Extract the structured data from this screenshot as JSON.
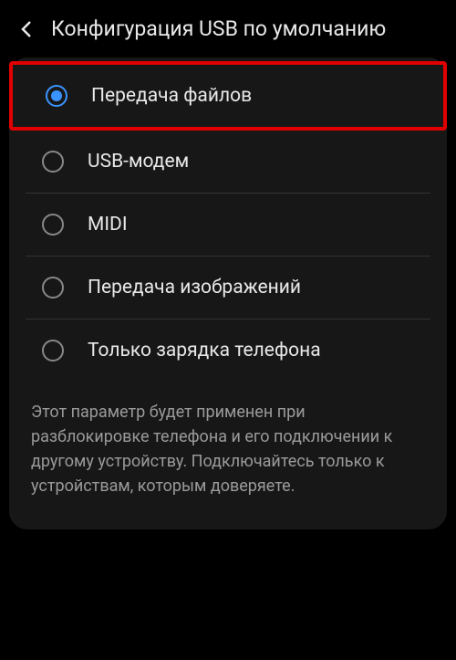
{
  "header": {
    "title": "Конфигурация USB по умолчанию"
  },
  "options": [
    {
      "label": "Передача файлов",
      "selected": true,
      "highlighted": true
    },
    {
      "label": "USB-модем",
      "selected": false,
      "highlighted": false
    },
    {
      "label": "MIDI",
      "selected": false,
      "highlighted": false
    },
    {
      "label": "Передача изображений",
      "selected": false,
      "highlighted": false
    },
    {
      "label": "Только зарядка телефона",
      "selected": false,
      "highlighted": false
    }
  ],
  "description": "Этот параметр будет применен при разблокировке телефона и его подключении к другому устройству. Подключайтесь только к устройствам, которым доверяете."
}
